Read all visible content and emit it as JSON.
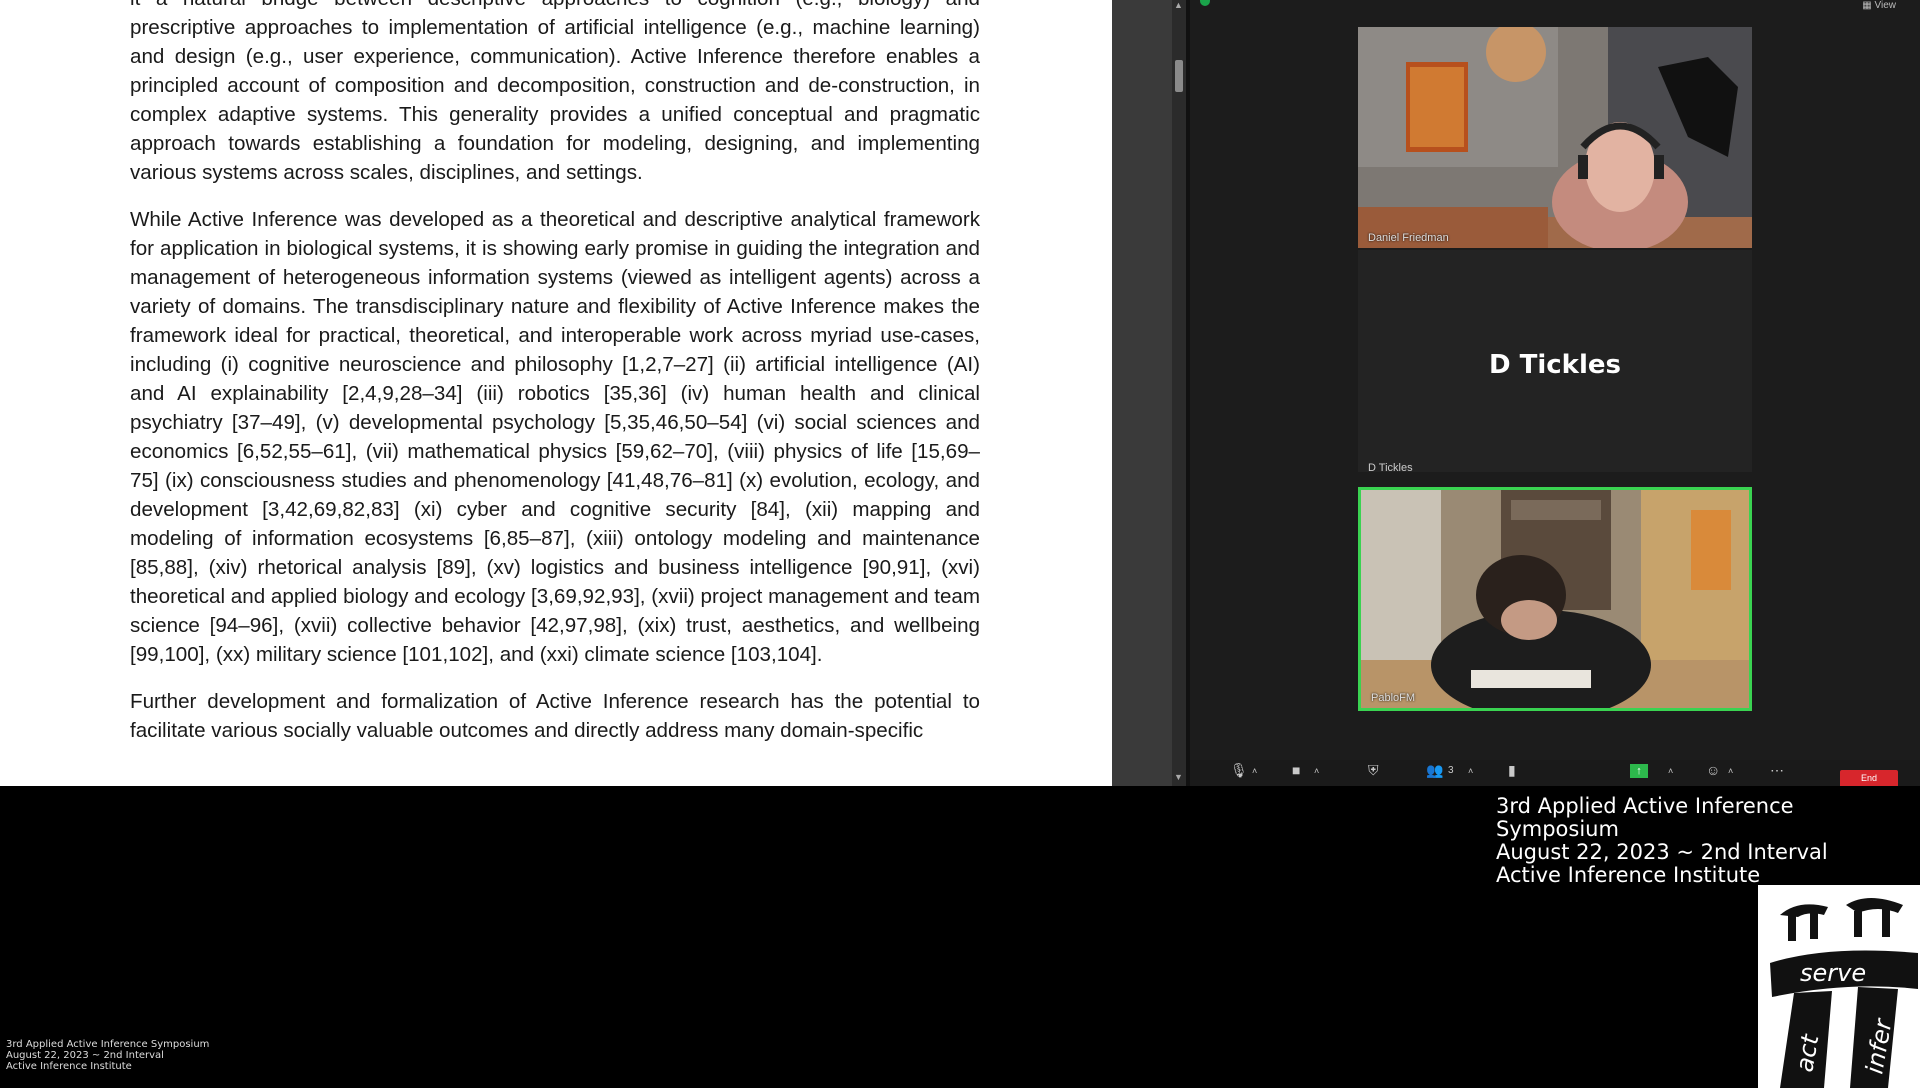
{
  "document": {
    "paragraphs": [
      "it a natural bridge between descriptive approaches to cognition (e.g., biology) and prescriptive approaches to implementation of artificial intelligence (e.g., machine learning) and design (e.g., user experience, communication). Active Inference therefore enables a principled account of composition and decomposition, construction and de-construction, in complex adaptive systems. This generality provides a unified conceptual and pragmatic approach towards establishing a foundation for modeling, designing, and implementing various systems across scales, disciplines, and settings.",
      "While Active Inference was developed as a theoretical and descriptive analytical framework for application in biological systems, it is showing early promise in guiding the integration and management of heterogeneous information systems (viewed as intelligent agents) across a variety of domains. The transdisciplinary nature and flexibility of Active Inference makes the framework ideal for practical, theoretical, and interoperable work across myriad use-cases, including (i) cognitive neuroscience and philosophy [1,2,7–27] (ii) artificial intelligence (AI) and AI explainability [2,4,9,28–34] (iii) robotics [35,36] (iv) human health and clinical psychiatry [37–49], (v) developmental psychology [5,35,46,50–54] (vi) social sciences and economics [6,52,55–61], (vii) mathematical physics [59,62–70], (viii) physics of life [15,69–75] (ix) consciousness studies and phenomenology [41,48,76–81] (x) evolution, ecology, and development [3,42,69,82,83] (xi) cyber and cognitive security [84], (xii) mapping and modeling of information ecosystems [6,85–87], (xiii) ontology modeling and maintenance [85,88], (xiv) rhetorical analysis [89], (xv) logistics and business intelligence [90,91], (xvi) theoretical and applied biology and ecology [3,69,92,93], (xvii) project management and team science [94–96], (xvii) collective behavior [42,97,98], (xix) trust, aesthetics, and wellbeing [99,100], (xx) military science [101,102], and (xxi) climate science [103,104].",
      "Further development and formalization of Active Inference research has the potential to facilitate various socially valuable outcomes and directly address many domain-specific"
    ]
  },
  "meeting": {
    "view_label": "View",
    "participants": [
      {
        "name": "Daniel Friedman",
        "video": true
      },
      {
        "name": "D Tickles",
        "display": "D Tickles",
        "video": false
      },
      {
        "name": "PabloFM",
        "video": true,
        "active_speaker": true
      }
    ],
    "toolbar": {
      "participants_count": "3",
      "end_label": "End"
    },
    "colors": {
      "active_border": "#3ad351",
      "end_button": "#d7262c",
      "status": "#1aa34a"
    }
  },
  "overlay": {
    "lines": [
      "3rd Applied Active Inference Symposium",
      "August 22, 2023 ~ 2nd Interval",
      "Active Inference Institute"
    ]
  },
  "logo": {
    "serve": "serve",
    "act": "act",
    "infer": "infer"
  }
}
